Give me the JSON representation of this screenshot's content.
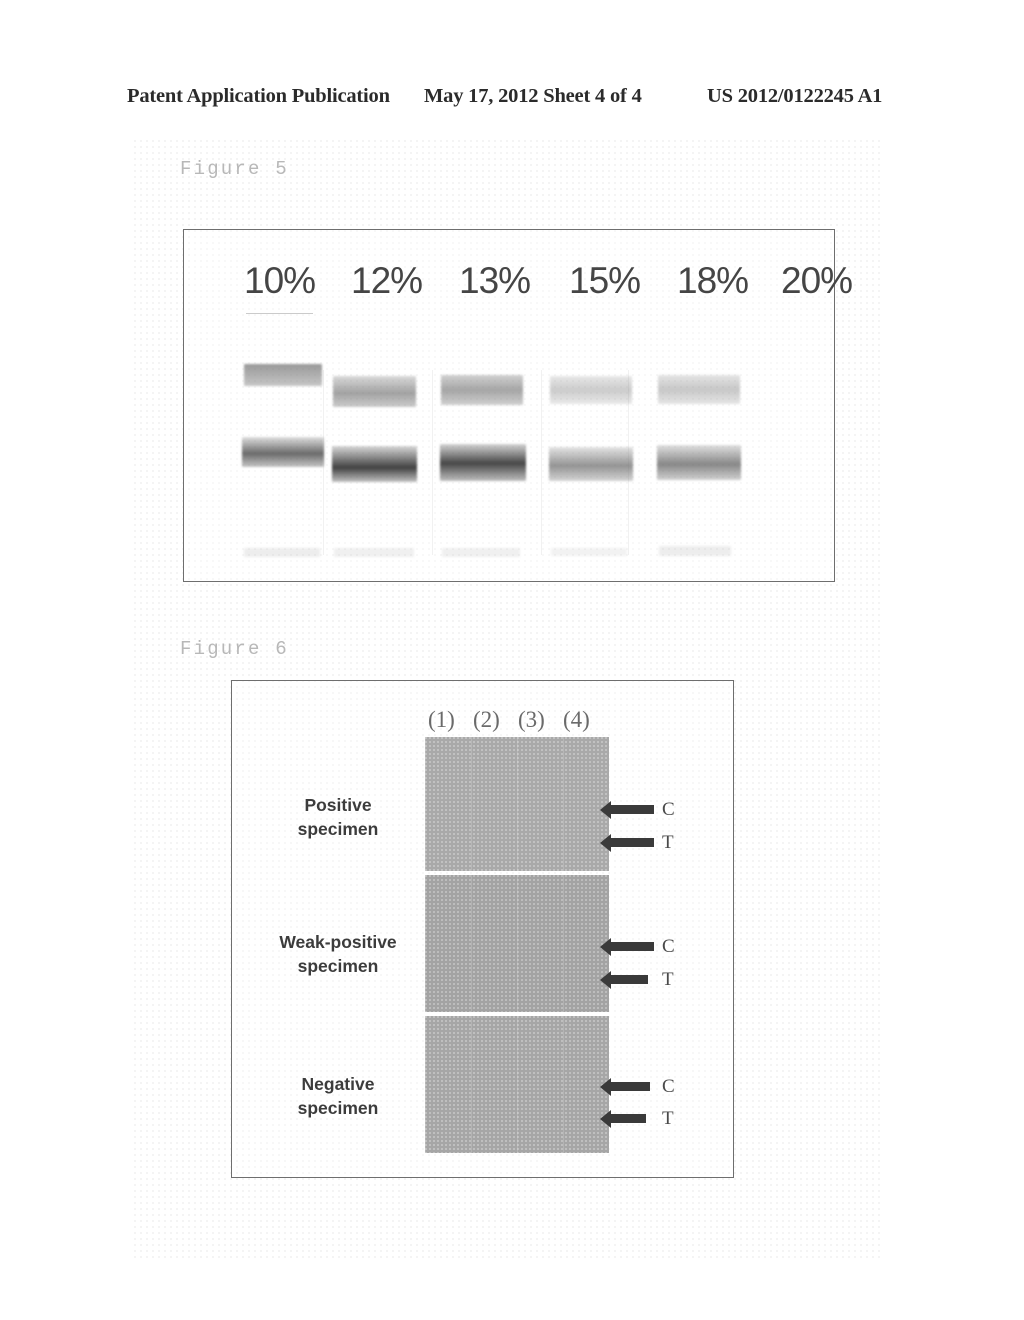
{
  "header": {
    "publication": "Patent Application Publication",
    "date_sheet": "May 17, 2012  Sheet 4 of 4",
    "patent_number": "US 2012/0122245 A1"
  },
  "figure5": {
    "caption": "Figure 5",
    "lane_labels": [
      "10%",
      "12%",
      "13%",
      "15%",
      "18%",
      "20%"
    ],
    "chart_data": {
      "type": "table",
      "title": "Figure 5",
      "description": "Electrophoresis gel: two bands per lane across six concentrations",
      "categories": [
        "10%",
        "12%",
        "13%",
        "15%",
        "18%",
        "20%"
      ],
      "series": [
        {
          "name": "upper band intensity",
          "values": [
            0.55,
            0.52,
            0.5,
            0.33,
            0.3,
            0.0
          ]
        },
        {
          "name": "lower band intensity",
          "values": [
            0.72,
            0.92,
            0.9,
            0.62,
            0.65,
            0.0
          ]
        }
      ]
    }
  },
  "figure6": {
    "caption": "Figure 6",
    "column_labels": [
      "(1)",
      "(2)",
      "(3)",
      "(4)"
    ],
    "panels": [
      {
        "name": "positive",
        "label_line1": "Positive",
        "label_line2": "specimen",
        "marker_c": "C",
        "marker_t": "T"
      },
      {
        "name": "weak",
        "label_line1": "Weak-positive",
        "label_line2": "specimen",
        "marker_c": "C",
        "marker_t": "T"
      },
      {
        "name": "negative",
        "label_line1": "Negative",
        "label_line2": "specimen",
        "marker_c": "C",
        "marker_t": "T"
      }
    ],
    "chart_data": {
      "type": "table",
      "title": "Figure 6",
      "description": "Lateral-flow test strips (1)-(4) for three specimen types with C (control) and T (test) line positions",
      "categories": [
        "(1)",
        "(2)",
        "(3)",
        "(4)"
      ],
      "rows": [
        "Positive specimen",
        "Weak-positive specimen",
        "Negative specimen"
      ],
      "markers": [
        "C",
        "T"
      ]
    }
  },
  "colors": {
    "ink": "#2b2b2b",
    "caption_gray": "#b8b8b8",
    "panel_gray": "#a9a9a9",
    "arrow": "#3a3a3a",
    "border": "#6e6e6e"
  }
}
